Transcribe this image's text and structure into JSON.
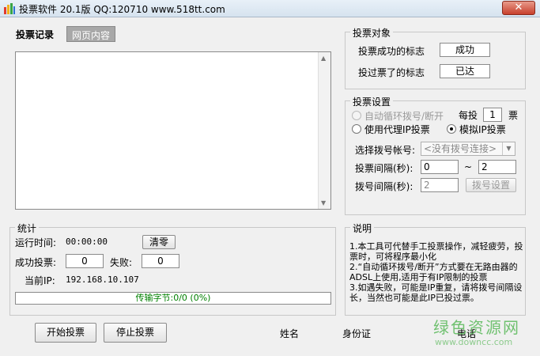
{
  "window": {
    "title": "投票软件 20.1版   QQ:120710   www.518tt.com",
    "close_label": "✕"
  },
  "tabs": [
    {
      "label": "投票记录"
    },
    {
      "label": "网页内容"
    }
  ],
  "vote_target": {
    "legend": "投票对象",
    "success_label": "投票成功的标志",
    "success_value": "成功",
    "voted_label": "投过票了的标志",
    "voted_value": "已达"
  },
  "vote_settings": {
    "legend": "投票设置",
    "auto_dial_label": "自动循环拨号/断开",
    "per_prefix": "每投",
    "per_value": "1",
    "per_suffix": "票",
    "proxy_label": "使用代理IP投票",
    "simulate_label": "模拟IP投票",
    "account_label": "选择拨号帐号:",
    "account_value": "<没有拨号连接>",
    "interval_label": "投票间隔(秒):",
    "interval_from": "0",
    "interval_sep": "~",
    "interval_to": "2",
    "dial_interval_label": "拨号间隔(秒):",
    "dial_interval_value": "2",
    "dial_settings_button": "拨号设置"
  },
  "stats": {
    "legend": "统计",
    "runtime_label": "运行时间:",
    "runtime_value": "00:00:00",
    "clear_button": "清零",
    "success_label": "成功投票:",
    "success_value": "0",
    "fail_label": "失败:",
    "fail_value": "0",
    "ip_label": "当前IP:",
    "ip_value": "192.168.10.107",
    "transfer_text": "传输字节:0/0 (0%)"
  },
  "notes": {
    "legend": "说明",
    "items": [
      "1.本工具可代替手工投票操作，减轻疲劳，投票时，可将程序最小化",
      "2.“自动循环拨号/断开”方式要在无路由器的ADSL上使用,适用于有IP限制的投票",
      "3.如遇失败，可能是IP重复，请将拨号间隔设长，当然也可能是此IP已投过票。"
    ]
  },
  "bottom": {
    "start_button": "开始投票",
    "stop_button": "停止投票",
    "name_label": "姓名",
    "id_label": "身份证",
    "phone_label": "电话"
  },
  "watermark": {
    "main": "绿色资源网",
    "sub": "www.downcc.com"
  },
  "colors": {
    "progress_text": "#008000",
    "watermark": "#5ab95a",
    "close_button": "#c8402c"
  }
}
